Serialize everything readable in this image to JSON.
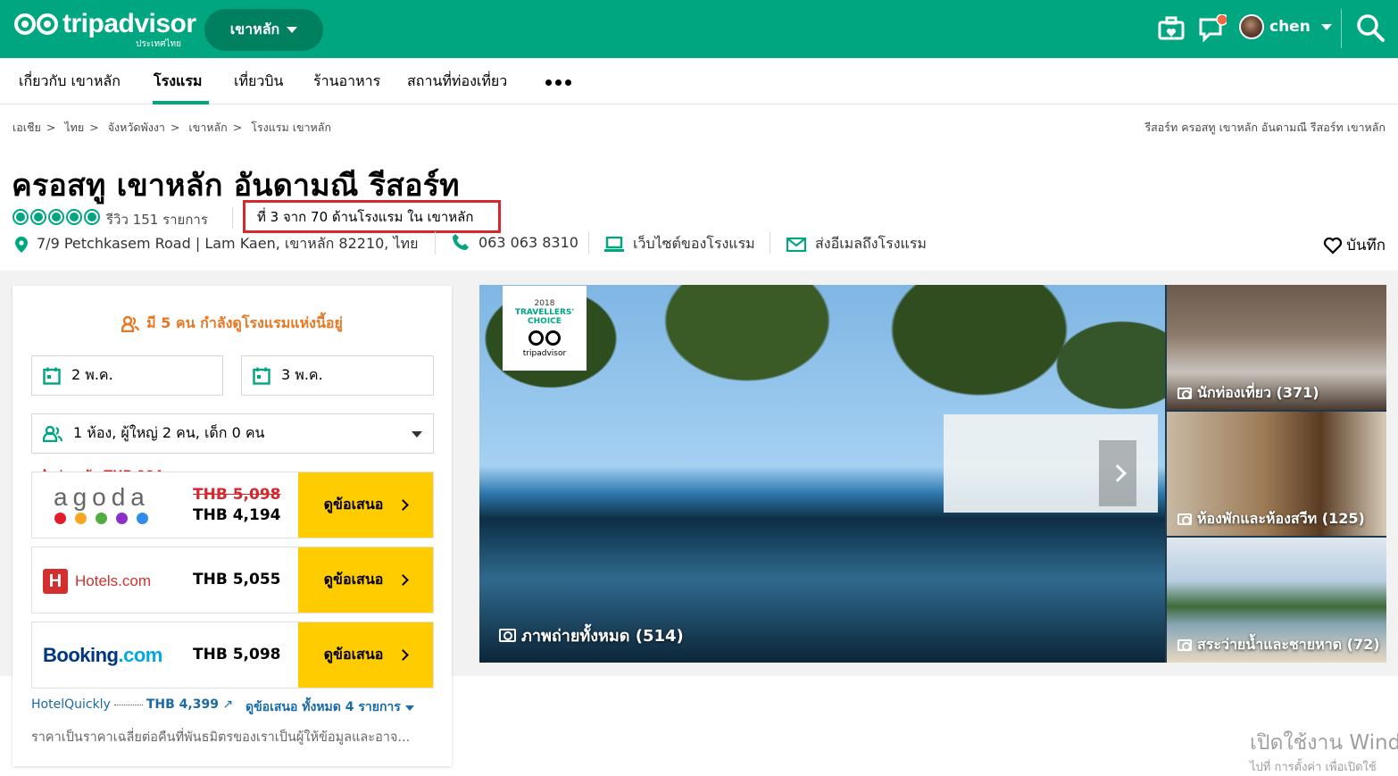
{
  "header": {
    "logo_word": "tripadvisor",
    "logo_sub": "ประเทศไทย",
    "geo_label": "เขาหลัก",
    "user_name": "chen"
  },
  "nav": {
    "items": [
      "เกี่ยวกับ เขาหลัก",
      "โรงแรม",
      "เที่ยวบิน",
      "ร้านอาหาร",
      "สถานที่ท่องเที่ยว"
    ],
    "active_index": 1
  },
  "breadcrumb": {
    "items": [
      "เอเชีย",
      "ไทย",
      "จังหวัดพังงา",
      "เขาหลัก",
      "โรงแรม เขาหลัก"
    ],
    "right_text": "รีสอร์ท ครอสทู เขาหลัก อันดามณี รีสอร์ท เขาหลัก"
  },
  "hotel": {
    "name": "ครอสทู เขาหลัก อันดามณี รีสอร์ท",
    "reviews": "รีวิว 151 รายการ",
    "rank": "ที่ 3 จาก 70 ด้านโรงแรม ใน เขาหลัก",
    "address": "7/9 Petchkasem Road | Lam Kaen, เขาหลัก 82210, ไทย",
    "phone": "063 063 8310",
    "website": "เว็บไซต์ของโรงแรม",
    "email": "ส่งอีเมลถึงโรงแรม",
    "save": "บันทึก",
    "rating_bubbles": 5
  },
  "booking": {
    "viewers": "มี 5 คน กำลังดูโรงแรมแห่งนี้อยู่",
    "checkin": "2 พ.ค.",
    "checkout": "3 พ.ค.",
    "guests": "1 ห้อง, ผู้ใหญ่ 2 คน, เด็ก 0 คน",
    "savings": "ประหยัด THB 904",
    "offers": [
      {
        "provider": "agoda",
        "old_price": "THB 5,098",
        "price": "THB 4,194",
        "button": "ดูข้อเสนอ"
      },
      {
        "provider": "Hotels.com",
        "price": "THB 5,055",
        "button": "ดูข้อเสนอ"
      },
      {
        "provider": "Booking",
        "provider_suffix": ".com",
        "price": "THB 5,098",
        "button": "ดูข้อเสนอ"
      }
    ],
    "extra_provider": "HotelQuickly",
    "extra_price": "THB 4,399",
    "all_offers": "ดูข้อเสนอ ทั้งหมด 4 รายการ",
    "note": "ราคาเป็นราคาเฉลี่ยต่อคืนที่พันธมิตรของเราเป็นผู้ให้ข้อมูลและอาจ..."
  },
  "gallery": {
    "badge_year": "2018",
    "badge_line1": "TRAVELLERS'",
    "badge_line2": "CHOICE",
    "badge_brand": "tripadvisor",
    "all_photos": "ภาพถ่ายทั้งหมด (514)",
    "thumbs": [
      "นักท่องเที่ยว (371)",
      "ห้องพักและห้องสวีท (125)",
      "สระว่ายน้ำและชายหาด (72)"
    ]
  },
  "os_watermark": {
    "line1": "เปิดใช้งาน Windo",
    "line2": "ไปที่ การตั้งค่า เพื่อเปิดใช้"
  },
  "colors": {
    "brand": "#00a680",
    "accent_yellow": "#ffcc00",
    "alert_red": "#d6262e",
    "viewer_orange": "#e87722"
  }
}
